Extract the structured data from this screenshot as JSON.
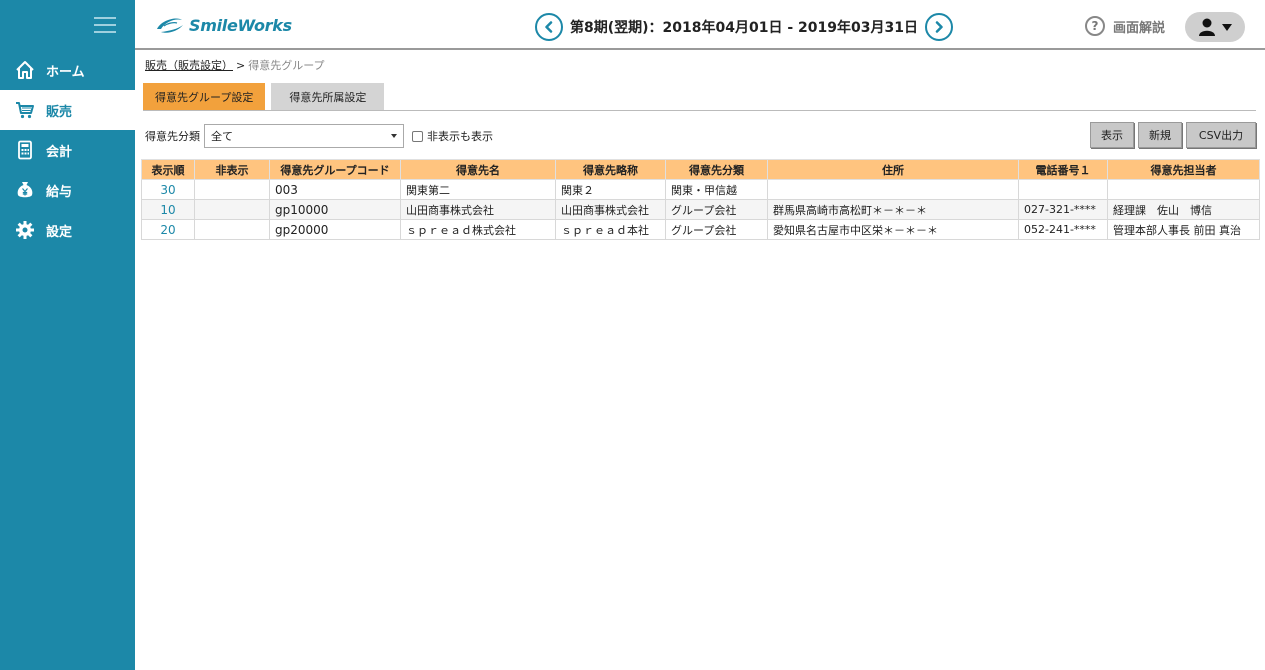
{
  "app": {
    "logo_text": "SmileWorks"
  },
  "sidebar": {
    "items": [
      {
        "label": "ホーム",
        "icon": "home-icon"
      },
      {
        "label": "販売",
        "icon": "cart-icon"
      },
      {
        "label": "会計",
        "icon": "calculator-icon"
      },
      {
        "label": "給与",
        "icon": "yen-bag-icon"
      },
      {
        "label": "設定",
        "icon": "gear-icon"
      }
    ],
    "active_index": 1
  },
  "header": {
    "period": "第8期(翌期)：2018年04月01日 - 2019年03月31日",
    "help_label": "画面解説"
  },
  "breadcrumb": {
    "parent": "販売（販売設定）",
    "separator": ">",
    "current": "得意先グループ"
  },
  "tabs": [
    {
      "label": "得意先グループ設定",
      "active": true
    },
    {
      "label": "得意先所属設定",
      "active": false
    }
  ],
  "filter": {
    "label": "得意先分類",
    "selected": "全て",
    "show_hidden_label": "非表示も表示",
    "show_hidden_checked": false
  },
  "actions": {
    "show": "表示",
    "new": "新規",
    "csv": "CSV出力"
  },
  "table": {
    "headers": [
      "表示順",
      "非表示",
      "得意先グループコード",
      "得意先名",
      "得意先略称",
      "得意先分類",
      "住所",
      "電話番号１",
      "得意先担当者"
    ],
    "rows": [
      {
        "order": "30",
        "hidden": "",
        "code": "003",
        "name": "関東第二",
        "short_name": "関東２",
        "category": "関東・甲信越",
        "address": "",
        "phone": "",
        "contact": ""
      },
      {
        "order": "10",
        "hidden": "",
        "code": "gp10000",
        "name": "山田商事株式会社",
        "short_name": "山田商事株式会社",
        "category": "グループ会社",
        "address": "群馬県高崎市高松町＊－＊－＊",
        "phone": "027-321-****",
        "contact": "経理課　佐山　博信"
      },
      {
        "order": "20",
        "hidden": "",
        "code": "gp20000",
        "name": "ｓｐｒｅａｄ株式会社",
        "short_name": "ｓｐｒｅａｄ本社",
        "category": "グループ会社",
        "address": "愛知県名古屋市中区栄＊－＊－＊",
        "phone": "052-241-****",
        "contact": "管理本部人事長 前田 真治"
      }
    ]
  },
  "colors": {
    "brand": "#1c88a8",
    "tab_active": "#f2a13c",
    "table_header": "#ffc47f"
  }
}
